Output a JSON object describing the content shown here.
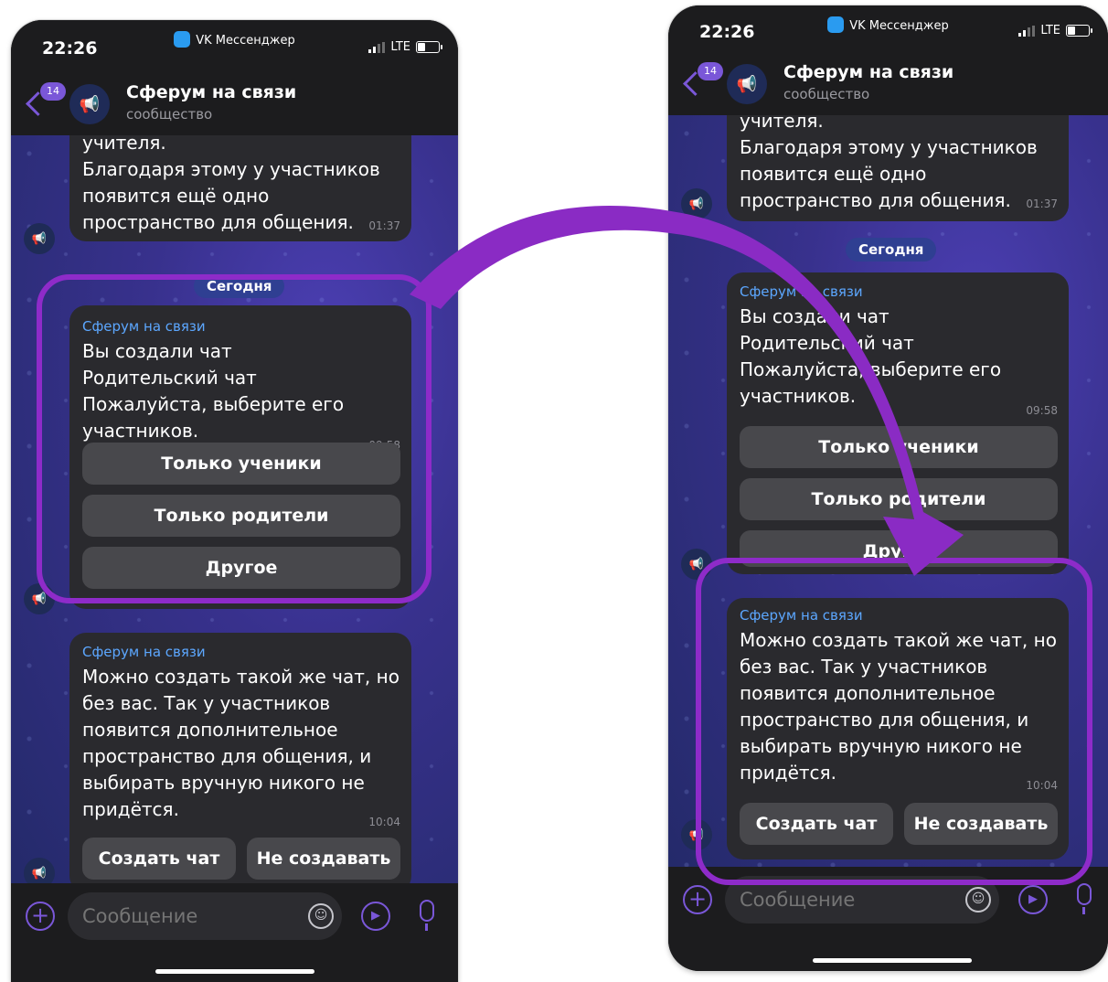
{
  "phones": {
    "left": {
      "status": {
        "time": "22:26",
        "app": "VK Мессенджер",
        "network": "LTE"
      },
      "header": {
        "unread": "14",
        "title": "Сферум на связи",
        "subtitle": "сообщество"
      },
      "prev_message": {
        "text_lines": [
          "учителя.",
          "Благодаря этому у участников",
          "появится ещё одно",
          "пространство для общения."
        ],
        "time": "01:37"
      },
      "date_separator": "Сегодня",
      "message1": {
        "sender": "Сферум на связи",
        "text_lines": [
          "Вы создали чат",
          "Родительский чат",
          "Пожалуйста, выберите его",
          "участников."
        ],
        "time": "09:58"
      },
      "keyboard": {
        "btn1": "Только ученики",
        "btn2": "Только родители",
        "btn3": "Другое"
      },
      "message2": {
        "sender": "Сферум на связи",
        "text_lines": [
          "Можно создать такой же чат, но",
          "без вас. Так у участников",
          "появится дополнительное",
          "пространство для общения, и",
          "выбирать вручную никого не",
          "придётся."
        ],
        "time": "10:04"
      },
      "actions": {
        "create": "Создать чат",
        "skip": "Не создавать"
      },
      "input": {
        "placeholder": "Сообщение"
      }
    },
    "right": {
      "status": {
        "time": "22:26",
        "app": "VK Мессенджер",
        "network": "LTE"
      },
      "header": {
        "unread": "14",
        "title": "Сферум на связи",
        "subtitle": "сообщество"
      },
      "prev_message": {
        "text_lines": [
          "учителя.",
          "Благодаря этому у участников",
          "появится ещё одно",
          "пространство для общения."
        ],
        "time": "01:37"
      },
      "date_separator": "Сегодня",
      "message1": {
        "sender": "Сферум на связи",
        "text_lines": [
          "Вы создали чат",
          "Родительский чат",
          "Пожалуйста, выберите его",
          "участников."
        ],
        "time": "09:58"
      },
      "keyboard": {
        "btn1": "Только ученики",
        "btn2": "Только родители",
        "btn3": "Другое"
      },
      "message2": {
        "sender": "Сферум на связи",
        "text_lines": [
          "Можно создать такой же чат, но",
          "без вас. Так у участников",
          "появится дополнительное",
          "пространство для общения, и",
          "выбирать вручную никого не",
          "придётся."
        ],
        "time": "10:04"
      },
      "actions": {
        "create": "Создать чат",
        "skip": "Не создавать"
      },
      "input": {
        "placeholder": "Сообщение"
      }
    }
  },
  "icons": {
    "back": "chevron-left-icon",
    "avatar": "megaphone-icon",
    "attach": "plus-icon",
    "emoji": "emoji-icon",
    "video": "video-message-icon",
    "mic": "microphone-icon"
  },
  "colors": {
    "accent": "#7a57d8",
    "highlight": "#8e2bc9",
    "sender_link": "#5ca7ff",
    "bubble": "#2a2a2e",
    "keyboard_button": "#48484c"
  }
}
